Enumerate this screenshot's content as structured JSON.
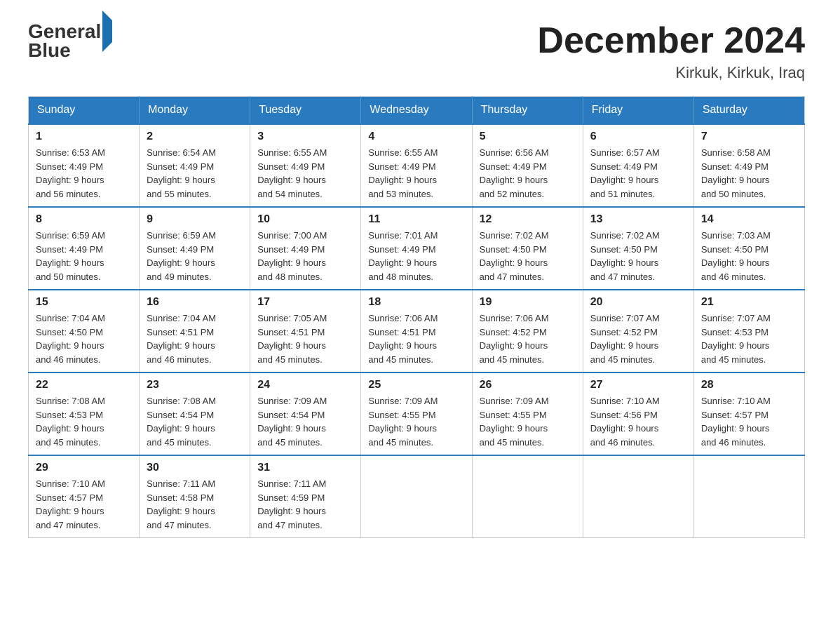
{
  "header": {
    "logo_text_general": "General",
    "logo_text_blue": "Blue",
    "title": "December 2024",
    "subtitle": "Kirkuk, Kirkuk, Iraq"
  },
  "calendar": {
    "days_of_week": [
      "Sunday",
      "Monday",
      "Tuesday",
      "Wednesday",
      "Thursday",
      "Friday",
      "Saturday"
    ],
    "weeks": [
      [
        {
          "day": "1",
          "sunrise": "6:53 AM",
          "sunset": "4:49 PM",
          "daylight": "9 hours and 56 minutes."
        },
        {
          "day": "2",
          "sunrise": "6:54 AM",
          "sunset": "4:49 PM",
          "daylight": "9 hours and 55 minutes."
        },
        {
          "day": "3",
          "sunrise": "6:55 AM",
          "sunset": "4:49 PM",
          "daylight": "9 hours and 54 minutes."
        },
        {
          "day": "4",
          "sunrise": "6:55 AM",
          "sunset": "4:49 PM",
          "daylight": "9 hours and 53 minutes."
        },
        {
          "day": "5",
          "sunrise": "6:56 AM",
          "sunset": "4:49 PM",
          "daylight": "9 hours and 52 minutes."
        },
        {
          "day": "6",
          "sunrise": "6:57 AM",
          "sunset": "4:49 PM",
          "daylight": "9 hours and 51 minutes."
        },
        {
          "day": "7",
          "sunrise": "6:58 AM",
          "sunset": "4:49 PM",
          "daylight": "9 hours and 50 minutes."
        }
      ],
      [
        {
          "day": "8",
          "sunrise": "6:59 AM",
          "sunset": "4:49 PM",
          "daylight": "9 hours and 50 minutes."
        },
        {
          "day": "9",
          "sunrise": "6:59 AM",
          "sunset": "4:49 PM",
          "daylight": "9 hours and 49 minutes."
        },
        {
          "day": "10",
          "sunrise": "7:00 AM",
          "sunset": "4:49 PM",
          "daylight": "9 hours and 48 minutes."
        },
        {
          "day": "11",
          "sunrise": "7:01 AM",
          "sunset": "4:49 PM",
          "daylight": "9 hours and 48 minutes."
        },
        {
          "day": "12",
          "sunrise": "7:02 AM",
          "sunset": "4:50 PM",
          "daylight": "9 hours and 47 minutes."
        },
        {
          "day": "13",
          "sunrise": "7:02 AM",
          "sunset": "4:50 PM",
          "daylight": "9 hours and 47 minutes."
        },
        {
          "day": "14",
          "sunrise": "7:03 AM",
          "sunset": "4:50 PM",
          "daylight": "9 hours and 46 minutes."
        }
      ],
      [
        {
          "day": "15",
          "sunrise": "7:04 AM",
          "sunset": "4:50 PM",
          "daylight": "9 hours and 46 minutes."
        },
        {
          "day": "16",
          "sunrise": "7:04 AM",
          "sunset": "4:51 PM",
          "daylight": "9 hours and 46 minutes."
        },
        {
          "day": "17",
          "sunrise": "7:05 AM",
          "sunset": "4:51 PM",
          "daylight": "9 hours and 45 minutes."
        },
        {
          "day": "18",
          "sunrise": "7:06 AM",
          "sunset": "4:51 PM",
          "daylight": "9 hours and 45 minutes."
        },
        {
          "day": "19",
          "sunrise": "7:06 AM",
          "sunset": "4:52 PM",
          "daylight": "9 hours and 45 minutes."
        },
        {
          "day": "20",
          "sunrise": "7:07 AM",
          "sunset": "4:52 PM",
          "daylight": "9 hours and 45 minutes."
        },
        {
          "day": "21",
          "sunrise": "7:07 AM",
          "sunset": "4:53 PM",
          "daylight": "9 hours and 45 minutes."
        }
      ],
      [
        {
          "day": "22",
          "sunrise": "7:08 AM",
          "sunset": "4:53 PM",
          "daylight": "9 hours and 45 minutes."
        },
        {
          "day": "23",
          "sunrise": "7:08 AM",
          "sunset": "4:54 PM",
          "daylight": "9 hours and 45 minutes."
        },
        {
          "day": "24",
          "sunrise": "7:09 AM",
          "sunset": "4:54 PM",
          "daylight": "9 hours and 45 minutes."
        },
        {
          "day": "25",
          "sunrise": "7:09 AM",
          "sunset": "4:55 PM",
          "daylight": "9 hours and 45 minutes."
        },
        {
          "day": "26",
          "sunrise": "7:09 AM",
          "sunset": "4:55 PM",
          "daylight": "9 hours and 45 minutes."
        },
        {
          "day": "27",
          "sunrise": "7:10 AM",
          "sunset": "4:56 PM",
          "daylight": "9 hours and 46 minutes."
        },
        {
          "day": "28",
          "sunrise": "7:10 AM",
          "sunset": "4:57 PM",
          "daylight": "9 hours and 46 minutes."
        }
      ],
      [
        {
          "day": "29",
          "sunrise": "7:10 AM",
          "sunset": "4:57 PM",
          "daylight": "9 hours and 47 minutes."
        },
        {
          "day": "30",
          "sunrise": "7:11 AM",
          "sunset": "4:58 PM",
          "daylight": "9 hours and 47 minutes."
        },
        {
          "day": "31",
          "sunrise": "7:11 AM",
          "sunset": "4:59 PM",
          "daylight": "9 hours and 47 minutes."
        },
        null,
        null,
        null,
        null
      ]
    ],
    "labels": {
      "sunrise": "Sunrise:",
      "sunset": "Sunset:",
      "daylight": "Daylight:"
    }
  }
}
